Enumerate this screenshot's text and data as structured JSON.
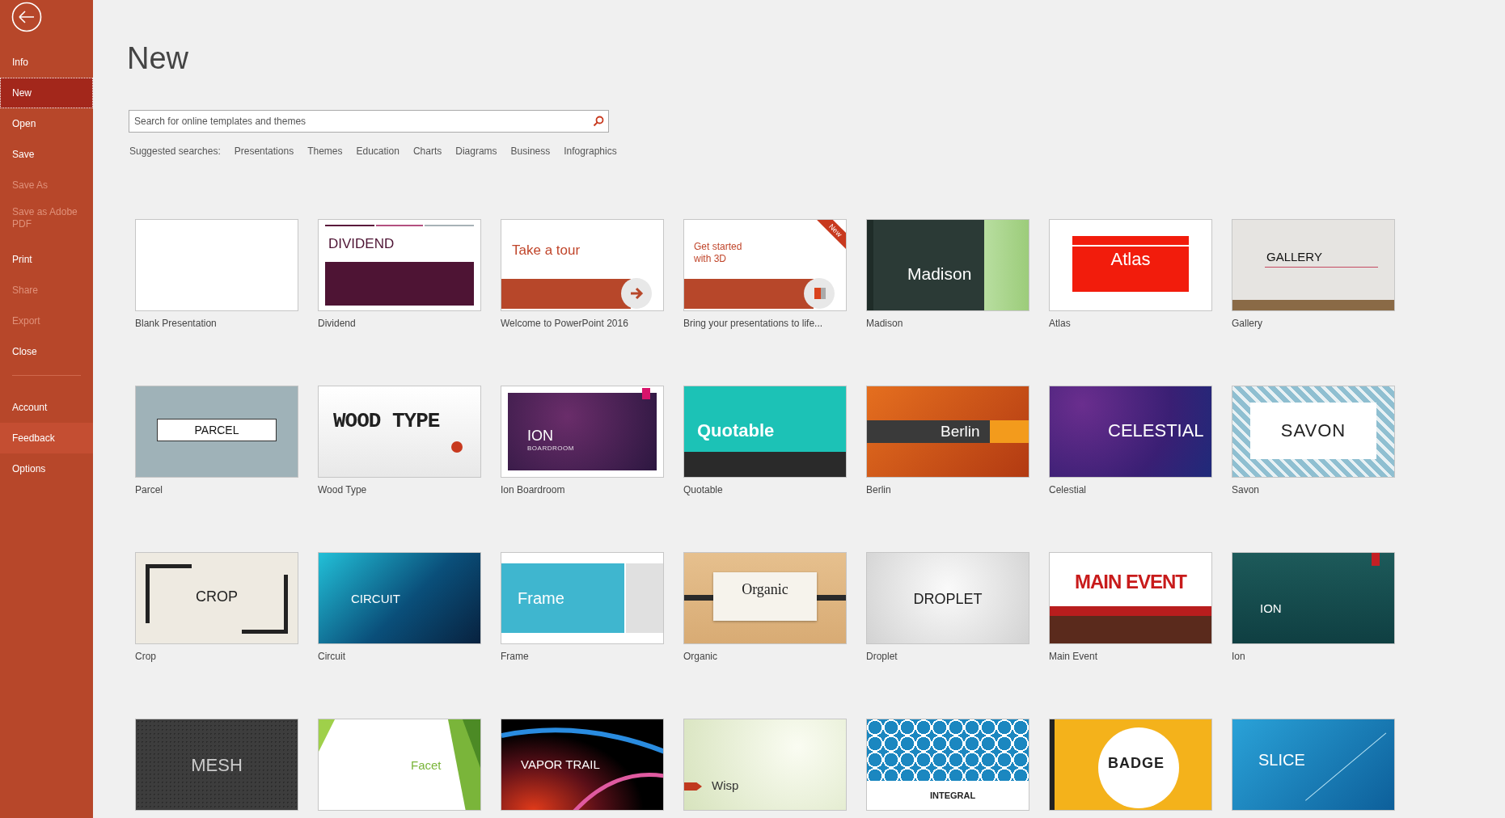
{
  "sidebar": {
    "items": [
      {
        "label": "Info",
        "selected": false,
        "disabled": false,
        "hovered": false
      },
      {
        "label": "New",
        "selected": true,
        "disabled": false,
        "hovered": false
      },
      {
        "label": "Open",
        "selected": false,
        "disabled": false,
        "hovered": false
      },
      {
        "label": "Save",
        "selected": false,
        "disabled": false,
        "hovered": false
      },
      {
        "label": "Save As",
        "selected": false,
        "disabled": true,
        "hovered": false
      },
      {
        "label": "Save as Adobe PDF",
        "selected": false,
        "disabled": true,
        "hovered": false
      },
      {
        "label": "Print",
        "selected": false,
        "disabled": false,
        "hovered": false
      },
      {
        "label": "Share",
        "selected": false,
        "disabled": true,
        "hovered": false
      },
      {
        "label": "Export",
        "selected": false,
        "disabled": true,
        "hovered": false
      },
      {
        "label": "Close",
        "selected": false,
        "disabled": false,
        "hovered": false
      },
      {
        "kind": "divider"
      },
      {
        "label": "Account",
        "selected": false,
        "disabled": false,
        "hovered": false
      },
      {
        "label": "Feedback",
        "selected": false,
        "disabled": false,
        "hovered": true
      },
      {
        "label": "Options",
        "selected": false,
        "disabled": false,
        "hovered": false
      }
    ]
  },
  "page": {
    "title": "New",
    "search": {
      "placeholder": "Search for online templates and themes"
    },
    "suggested_label": "Suggested searches:",
    "suggested": [
      "Presentations",
      "Themes",
      "Education",
      "Charts",
      "Diagrams",
      "Business",
      "Infographics"
    ],
    "templates": [
      {
        "kind": "blank",
        "label": "Blank Presentation"
      },
      {
        "kind": "dividend",
        "label": "Dividend",
        "slide_lines": [
          "DIVIDEND"
        ]
      },
      {
        "kind": "tour",
        "label": "Welcome to PowerPoint 2016",
        "slide_lines": [
          "Take a tour"
        ]
      },
      {
        "kind": "threed",
        "label": "Bring your presentations to life...",
        "slide_lines": [
          "Get started",
          "with 3D"
        ],
        "badge": "New"
      },
      {
        "kind": "madison",
        "label": "Madison",
        "slide_lines": [
          "Madison"
        ]
      },
      {
        "kind": "atlas",
        "label": "Atlas",
        "slide_lines": [
          "Atlas"
        ]
      },
      {
        "kind": "gallery",
        "label": "Gallery",
        "slide_lines": [
          "GALLERY"
        ]
      },
      {
        "kind": "parcel",
        "label": "Parcel",
        "slide_lines": [
          "PARCEL"
        ]
      },
      {
        "kind": "woodtype",
        "label": "Wood Type",
        "slide_lines": [
          "WOOD TYPE"
        ]
      },
      {
        "kind": "boardroom",
        "label": "Ion Boardroom",
        "slide_lines": [
          "ION",
          "BOARDROOM"
        ]
      },
      {
        "kind": "quotable",
        "label": "Quotable",
        "slide_lines": [
          "Quotable"
        ]
      },
      {
        "kind": "berlin",
        "label": "Berlin",
        "slide_lines": [
          "Berlin"
        ]
      },
      {
        "kind": "celestial",
        "label": "Celestial",
        "slide_lines": [
          "CELESTIAL"
        ]
      },
      {
        "kind": "savon",
        "label": "Savon",
        "slide_lines": [
          "SAVON"
        ]
      },
      {
        "kind": "crop",
        "label": "Crop",
        "slide_lines": [
          "CROP"
        ]
      },
      {
        "kind": "circuit",
        "label": "Circuit",
        "slide_lines": [
          "CIRCUIT"
        ]
      },
      {
        "kind": "frame",
        "label": "Frame",
        "slide_lines": [
          "Frame"
        ]
      },
      {
        "kind": "organic",
        "label": "Organic",
        "slide_lines": [
          "Organic"
        ]
      },
      {
        "kind": "droplet",
        "label": "Droplet",
        "slide_lines": [
          "DROPLET"
        ]
      },
      {
        "kind": "mainevent",
        "label": "Main Event",
        "slide_lines": [
          "MAIN EVENT"
        ]
      },
      {
        "kind": "ion",
        "label": "Ion",
        "slide_lines": [
          "ION"
        ]
      },
      {
        "kind": "mesh",
        "slide_lines": [
          "MESH"
        ]
      },
      {
        "kind": "facet",
        "slide_lines": [
          "Facet"
        ]
      },
      {
        "kind": "vapor",
        "slide_lines": [
          "VAPOR TRAIL"
        ]
      },
      {
        "kind": "wisp",
        "slide_lines": [
          "Wisp"
        ]
      },
      {
        "kind": "integral",
        "slide_lines": [
          "INTEGRAL"
        ]
      },
      {
        "kind": "badge",
        "slide_lines": [
          "BADGE"
        ]
      },
      {
        "kind": "slice",
        "slide_lines": [
          "SLICE"
        ]
      }
    ]
  }
}
